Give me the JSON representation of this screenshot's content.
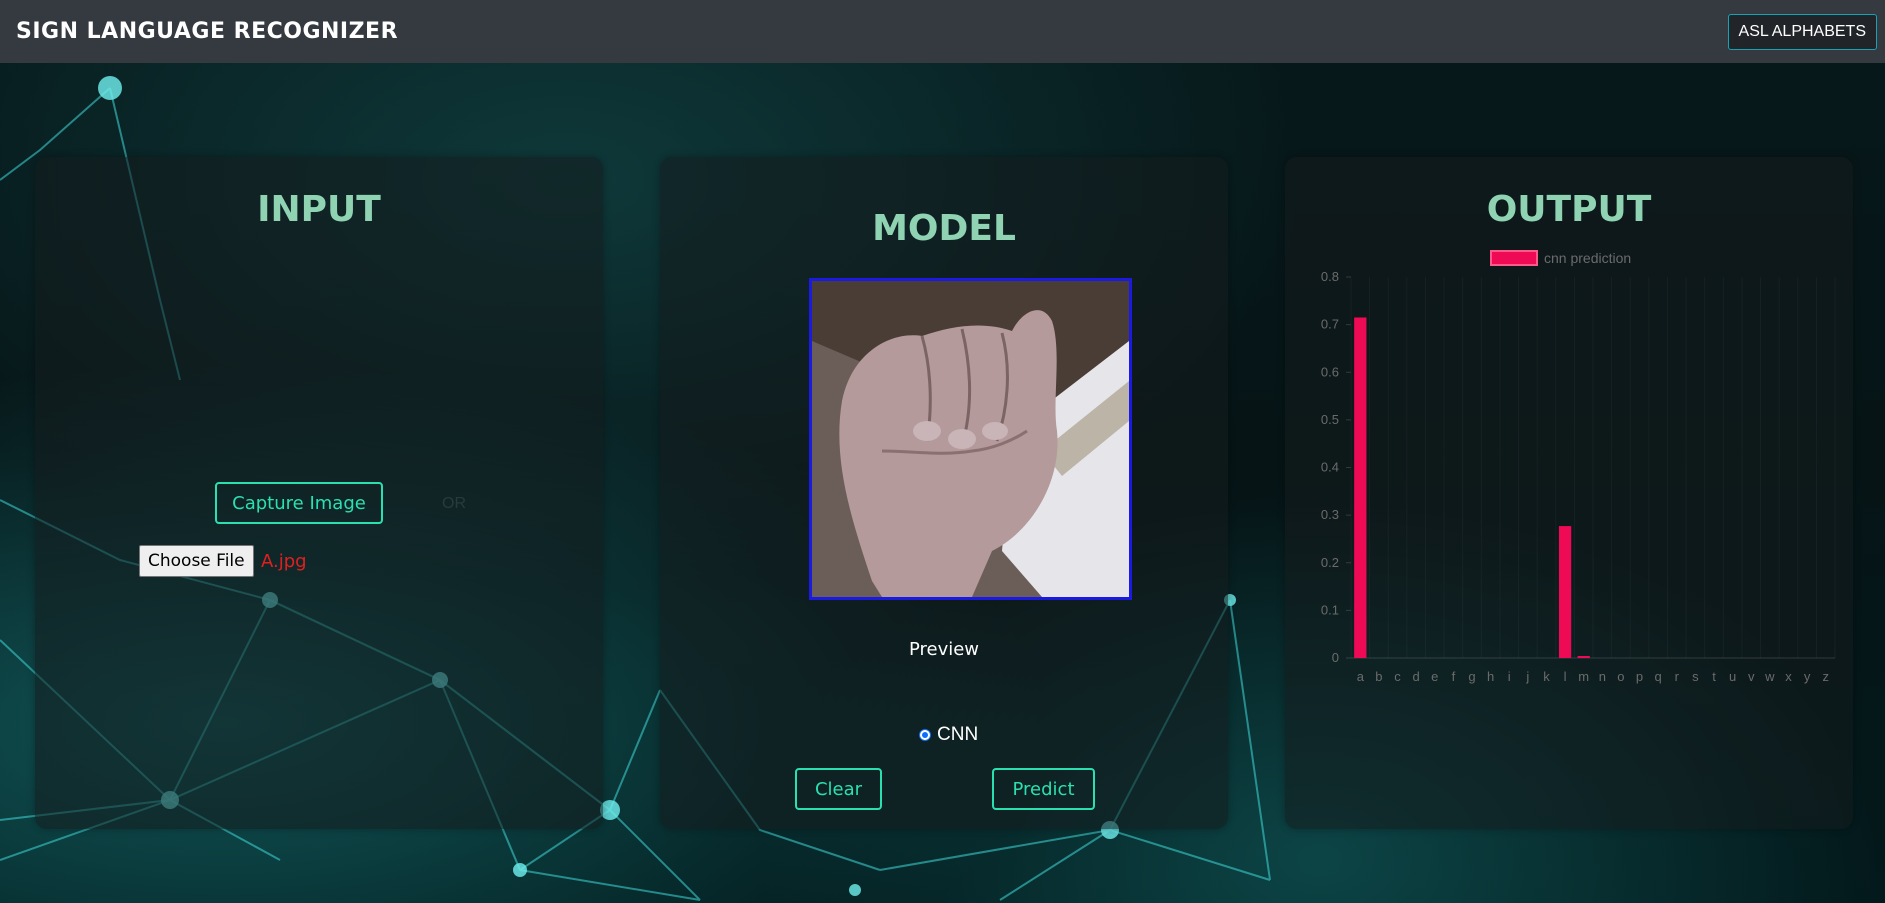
{
  "header": {
    "brand": "SIGN LANGUAGE RECOGNIZER",
    "asl_button": "ASL ALPHABETS"
  },
  "input_card": {
    "title": "INPUT",
    "capture_label": "Capture Image",
    "or_text": "OR",
    "choose_file_label": "Choose File",
    "file_name": "A.jpg"
  },
  "model_card": {
    "title": "MODEL",
    "preview_label": "Preview",
    "model_option": "CNN",
    "clear_label": "Clear",
    "predict_label": "Predict"
  },
  "output_card": {
    "title": "OUTPUT"
  },
  "colors": {
    "accent": "#2be0b0",
    "title": "#8fd3b3",
    "bar": "#ef0a55",
    "topbar": "#343a40"
  },
  "chart_data": {
    "type": "bar",
    "categories": [
      "a",
      "b",
      "c",
      "d",
      "e",
      "f",
      "g",
      "h",
      "i",
      "j",
      "k",
      "l",
      "m",
      "n",
      "o",
      "p",
      "q",
      "r",
      "s",
      "t",
      "u",
      "v",
      "w",
      "x",
      "y",
      "z"
    ],
    "series": [
      {
        "name": "cnn prediction",
        "values": [
          0.715,
          0,
          0,
          0,
          0,
          0,
          0,
          0,
          0,
          0,
          0,
          0.277,
          0.004,
          0,
          0,
          0,
          0,
          0,
          0,
          0,
          0,
          0,
          0,
          0,
          0,
          0
        ]
      }
    ],
    "ylim": [
      0,
      0.8
    ],
    "yticks": [
      "0",
      "0.1",
      "0.2",
      "0.3",
      "0.4",
      "0.5",
      "0.6",
      "0.7",
      "0.8"
    ],
    "legend_position": "top-center"
  }
}
